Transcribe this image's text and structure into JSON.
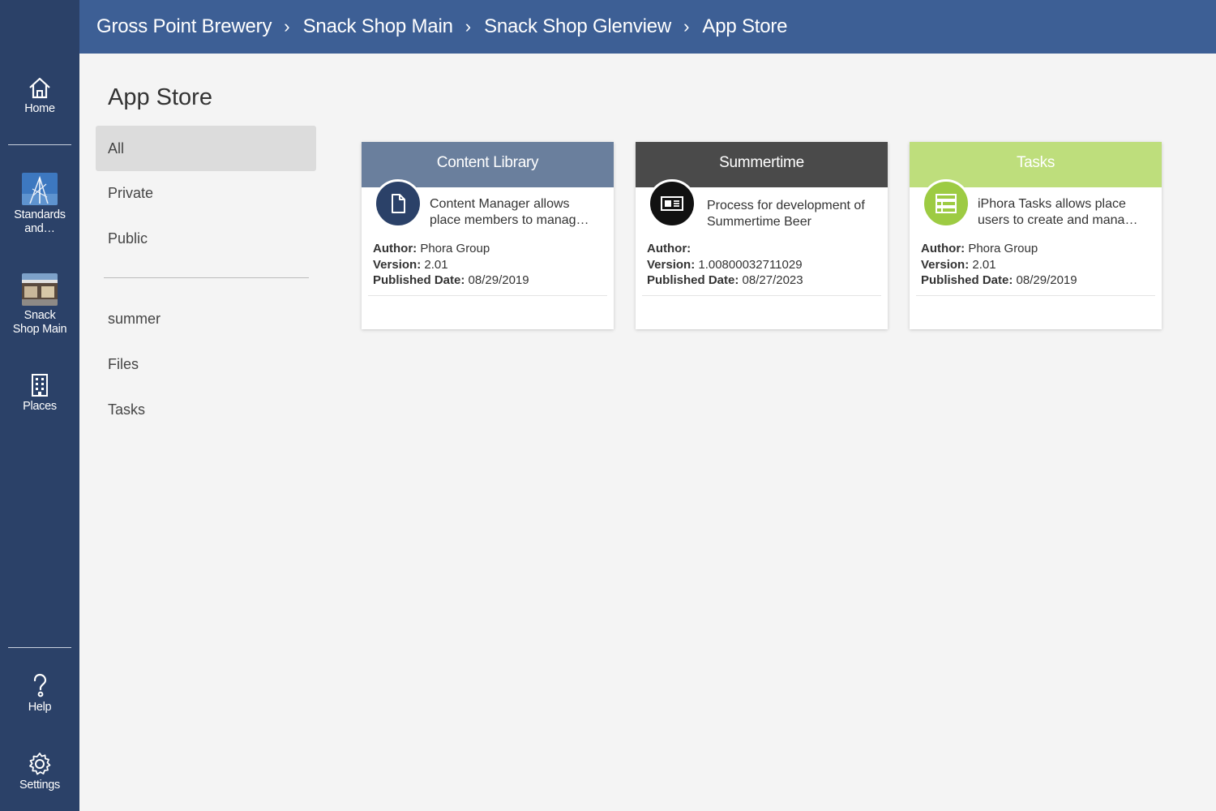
{
  "rail": {
    "home_label": "Home",
    "standards_label_1": "Standards",
    "standards_label_2": "and…",
    "snack_label_1": "Snack",
    "snack_label_2": "Shop Main",
    "places_label": "Places",
    "help_label": "Help",
    "settings_label": "Settings",
    "icons": [
      "home-icon",
      "standards-thumbnail",
      "snack-shop-thumbnail",
      "building-icon",
      "help-icon",
      "gear-icon"
    ]
  },
  "breadcrumb": [
    "Gross Point Brewery",
    "Snack Shop Main",
    "Snack Shop Glenview",
    "App Store"
  ],
  "breadcrumb_separator": "›",
  "page_title": "App Store",
  "filters": [
    "All",
    "Private",
    "Public"
  ],
  "categories": [
    "summer",
    "Files",
    "Tasks"
  ],
  "active_filter": "All",
  "meta_labels": {
    "author": "Author:",
    "version": "Version:",
    "published": "Published Date:"
  },
  "cards": [
    {
      "title": "Content Library",
      "header_color": "#6a7f9d",
      "circle_color": "#2b4168",
      "icon": "document-icon",
      "desc_line1": "Content Manager allows",
      "desc_line2": "place members to manag…",
      "author": "Phora Group",
      "version": "2.01",
      "published": "08/29/2019"
    },
    {
      "title": "Summertime",
      "header_color": "#4a4a4a",
      "circle_color": "#111111",
      "icon": "newspaper-icon",
      "desc_line1": "Process for development of",
      "desc_line2": "Summertime Beer",
      "author": "",
      "version": "1.00800032711029",
      "published": "08/27/2023"
    },
    {
      "title": "Tasks",
      "header_color": "#bede7c",
      "circle_color": "#9dcb43",
      "icon": "tasks-list-icon",
      "desc_line1": "iPhora Tasks allows place",
      "desc_line2": "users to create and mana…",
      "author": "Phora Group",
      "version": "2.01",
      "published": "08/29/2019"
    }
  ]
}
